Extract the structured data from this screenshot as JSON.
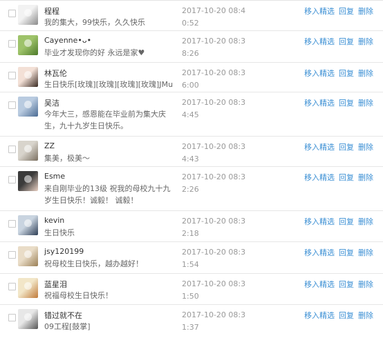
{
  "actions": {
    "feature": "移入精选",
    "reply": "回复",
    "delete": "删除"
  },
  "comments": [
    {
      "name": "程程",
      "message": "我的集大，99快乐，久久快乐",
      "time": "2017-10-20 08:4\n0:52",
      "avatar": "user-avatar-sketch"
    },
    {
      "name": "Cayenne•ᴗ•",
      "message": "毕业才发现你的好 永远是家♥",
      "time": "2017-10-20 08:3\n8:26",
      "avatar": "user-avatar-grass"
    },
    {
      "name": "林瓦伦",
      "message": "生日快乐[玫瑰][玫瑰][玫瑰][玫瑰]JMu",
      "time": "2017-10-20 08:3\n6:00",
      "avatar": "user-avatar-portrait"
    },
    {
      "name": "吴洁",
      "message": "今年大三，感恩能在毕业前为集大庆生，九十九岁生日快乐。",
      "time": "2017-10-20 08:3\n4:45",
      "avatar": "user-avatar-sea"
    },
    {
      "name": "ZZ",
      "message": "集美，极美～",
      "time": "2017-10-20 08:3\n4:43",
      "avatar": "user-avatar-street"
    },
    {
      "name": "Esme",
      "message": "来自刚毕业的13级 祝我的母校九十九岁生日快乐！诚毅！ 诚毅！",
      "time": "2017-10-20 08:3\n2:26",
      "avatar": "user-avatar-girl"
    },
    {
      "name": "kevin",
      "message": "生日快乐",
      "time": "2017-10-20 08:3\n2:18",
      "avatar": "user-avatar-tower"
    },
    {
      "name": "jsy120199",
      "message": "祝母校生日快乐，越办越好！",
      "time": "2017-10-20 08:3\n1:54",
      "avatar": "user-avatar-room"
    },
    {
      "name": "蓝星泪",
      "message": "祝福母校生日快乐！",
      "time": "2017-10-20 08:3\n1:50",
      "avatar": "user-avatar-cartoon"
    },
    {
      "name": "错过就不在",
      "message": "09工程[鼓掌]",
      "time": "2017-10-20 08:3\n1:37",
      "avatar": "user-avatar-face"
    }
  ]
}
